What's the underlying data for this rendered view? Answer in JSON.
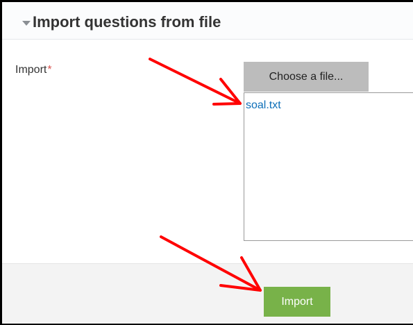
{
  "section": {
    "title": "Import questions from file",
    "collapse_icon": "triangle-down-icon"
  },
  "form": {
    "import_label": "Import",
    "required_marker": "*",
    "choose_file_label": "Choose a file...",
    "selected_file": "soal.txt"
  },
  "footer": {
    "import_button_label": "Import"
  },
  "annotations": {
    "arrow_color": "#ff0000",
    "arrow_icon": "red-arrow-icon"
  },
  "colors": {
    "import_button": "#78b249",
    "choose_button": "#bcbcbc",
    "file_link": "#0d6fb8",
    "required": "#d9534f"
  }
}
